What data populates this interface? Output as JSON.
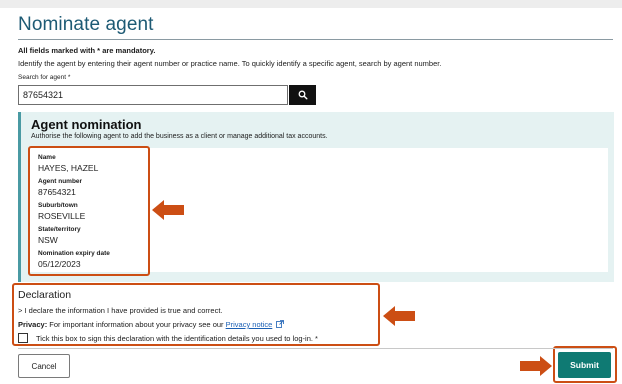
{
  "page": {
    "title": "Nominate agent",
    "mandatory_note": "All fields marked with * are mandatory.",
    "instruction": "Identify the agent by entering their agent number or practice name. To quickly identify a specific agent, search by agent number."
  },
  "search": {
    "label": "Search for agent *",
    "value": "87654321",
    "button_icon": "search-icon"
  },
  "nomination": {
    "heading": "Agent nomination",
    "description": "Authorise the following agent to add the business as a client or manage additional tax accounts.",
    "fields": [
      {
        "label": "Name",
        "value": "HAYES, HAZEL"
      },
      {
        "label": "Agent number",
        "value": "87654321"
      },
      {
        "label": "Suburb/town",
        "value": "ROSEVILLE"
      },
      {
        "label": "State/territory",
        "value": "NSW"
      },
      {
        "label": "Nomination expiry date",
        "value": "05/12/2023"
      }
    ]
  },
  "declaration": {
    "heading": "Declaration",
    "statement": "I declare the information I have provided is true and correct.",
    "privacy_label": "Privacy:",
    "privacy_text": "For important information about your privacy see our",
    "privacy_link": "Privacy notice",
    "checkbox_label": "Tick this box to sign this declaration with the identification details you used to log-in. *",
    "checkbox_checked": false
  },
  "footer": {
    "cancel_label": "Cancel",
    "submit_label": "Submit"
  },
  "colors": {
    "title": "#1d5a74",
    "panel_bg": "#e5f2f2",
    "panel_border": "#4a9aa3",
    "highlight": "#cc4e14",
    "submit_bg": "#0f7a73",
    "link": "#1a5fb4"
  }
}
